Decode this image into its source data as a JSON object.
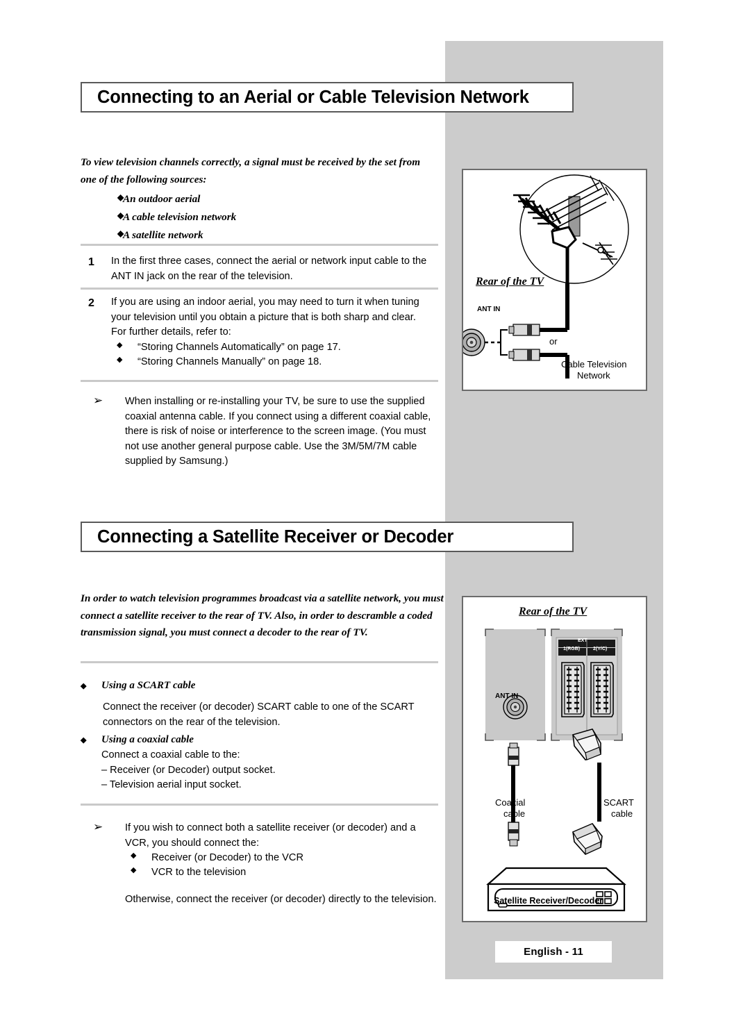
{
  "page": {
    "footer_label": "English - 11",
    "band_color": "#cccccc"
  },
  "section1": {
    "title": "Connecting to an Aerial or Cable Television Network",
    "intro": "To view television channels correctly, a signal must be received by the set from one of the following sources:",
    "intro_bullets": [
      "An outdoor aerial",
      "A cable television network",
      "A satellite network"
    ],
    "steps": [
      {
        "number": "1",
        "text": "In the first three cases, connect the aerial or network input cable to the ANT IN jack on the rear of the television."
      },
      {
        "number": "2",
        "text": "If you are using an indoor aerial, you may need to turn it when tuning your television until you obtain a picture that is both sharp and clear.",
        "text2": "For further details, refer to:",
        "bullets": [
          "“Storing Channels Automatically” on page 17.",
          "“Storing Channels Manually” on page 18."
        ]
      }
    ],
    "note": "When installing or re-installing your TV, be sure to use the supplied coaxial antenna cable. If you connect using a different coaxial cable, there is risk of noise or interference to the screen image. (You must not use another general purpose cable. Use the 3M/5M/7M cable supplied by Samsung.)"
  },
  "diagram1": {
    "rear_label": "Rear of the TV",
    "ant_in_label": "ANT IN",
    "or_label": "or",
    "cable_line1": "Cable Television",
    "cable_line2": "Network"
  },
  "section2": {
    "title": "Connecting a Satellite Receiver or Decoder",
    "intro": "In order to watch television programmes broadcast via a satellite network, you must connect a satellite receiver to the rear of TV. Also, in order to descramble a coded transmission signal, you must connect a decoder to the rear of TV.",
    "scart_heading": "Using a SCART cable",
    "scart_text": "Connect the receiver (or decoder) SCART cable to one of the SCART connectors on the rear of the television.",
    "coax_heading": "Using a coaxial cable",
    "coax_text": "Connect a coaxial cable to the:",
    "coax_items": [
      "– Receiver (or Decoder) output socket.",
      "– Television aerial input socket."
    ],
    "note_intro": "If you wish to connect both a satellite receiver (or decoder) and a VCR, you should connect the:",
    "note_bullets": [
      "Receiver (or Decoder) to the VCR",
      "VCR to the television"
    ],
    "note_outro": "Otherwise, connect the receiver (or decoder) directly to the television."
  },
  "diagram2": {
    "rear_label": "Rear of the TV",
    "ant_in_label": "ANT IN",
    "ext_label": "EXT",
    "scart1_label": "1(RGB)",
    "scart2_label": "2(Y/C)",
    "coax_line1": "Coaxial",
    "coax_line2": "cable",
    "scart_line1": "SCART",
    "scart_line2": "cable",
    "device_label": "Satellite Receiver/Decoder"
  },
  "glyphs": {
    "diamond": "◆",
    "arrow": "➢"
  }
}
